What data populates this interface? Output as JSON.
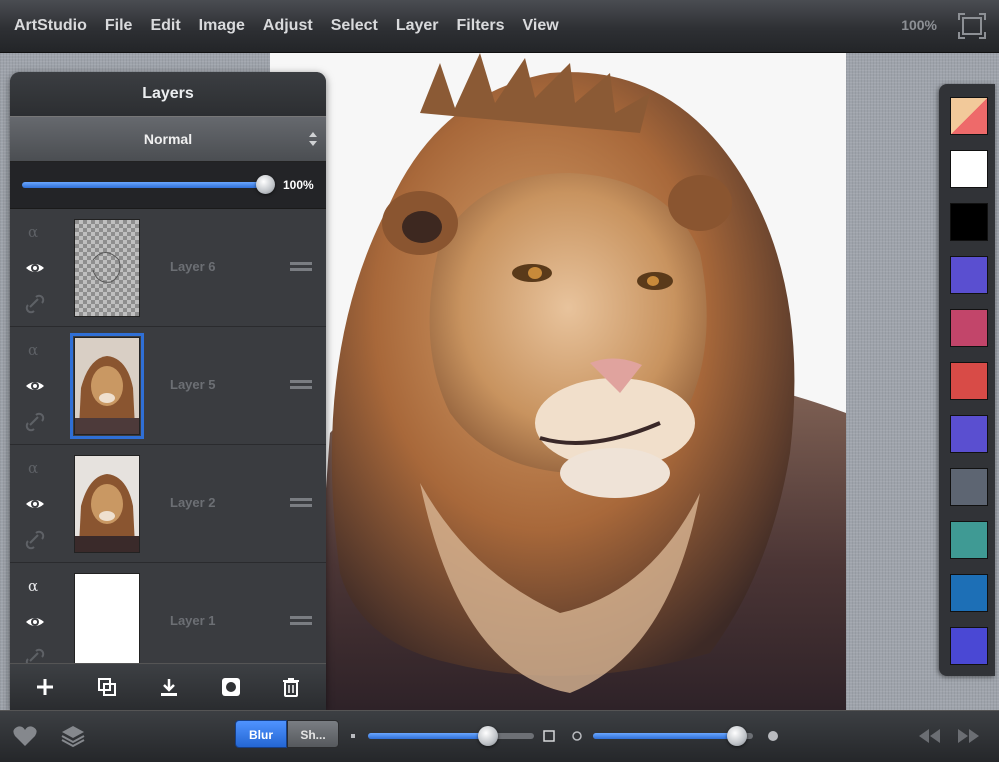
{
  "menubar": {
    "app_name": "ArtStudio",
    "items": [
      "File",
      "Edit",
      "Image",
      "Adjust",
      "Select",
      "Layer",
      "Filters",
      "View"
    ],
    "zoom": "100%"
  },
  "layers_panel": {
    "title": "Layers",
    "blend_mode": "Normal",
    "opacity_value": 1.0,
    "opacity_label": "100%",
    "layers": [
      {
        "name": "Layer 6",
        "visible": true,
        "selected": false,
        "thumb": "sketch"
      },
      {
        "name": "Layer 5",
        "visible": true,
        "selected": true,
        "thumb": "lion"
      },
      {
        "name": "Layer 2",
        "visible": true,
        "selected": false,
        "thumb": "lion"
      },
      {
        "name": "Layer 1",
        "visible": true,
        "selected": false,
        "thumb": "white"
      }
    ],
    "toolbar": [
      "add-layer-icon",
      "duplicate-layer-icon",
      "merge-down-icon",
      "mask-icon",
      "trash-icon"
    ]
  },
  "palette": {
    "swatches": [
      "#f2c99a",
      "#ffffff",
      "#000000",
      "#5a4fd0",
      "#c2456a",
      "#d84b47",
      "#5a4fd0",
      "#5d6572",
      "#3f9a94",
      "#1d6fb6",
      "#4a48d4"
    ]
  },
  "bottombar": {
    "blur_label": "Blur",
    "sharpen_label": "Sh...",
    "slider1_value": 0.72,
    "slider2_value": 0.9,
    "icons": [
      "heart-icon",
      "layers-icon",
      "rewind-icon",
      "forward-icon"
    ]
  },
  "colors": {
    "accent": "#2f6fd6",
    "panel": "#2f3134",
    "menubar": "#2e3034"
  }
}
